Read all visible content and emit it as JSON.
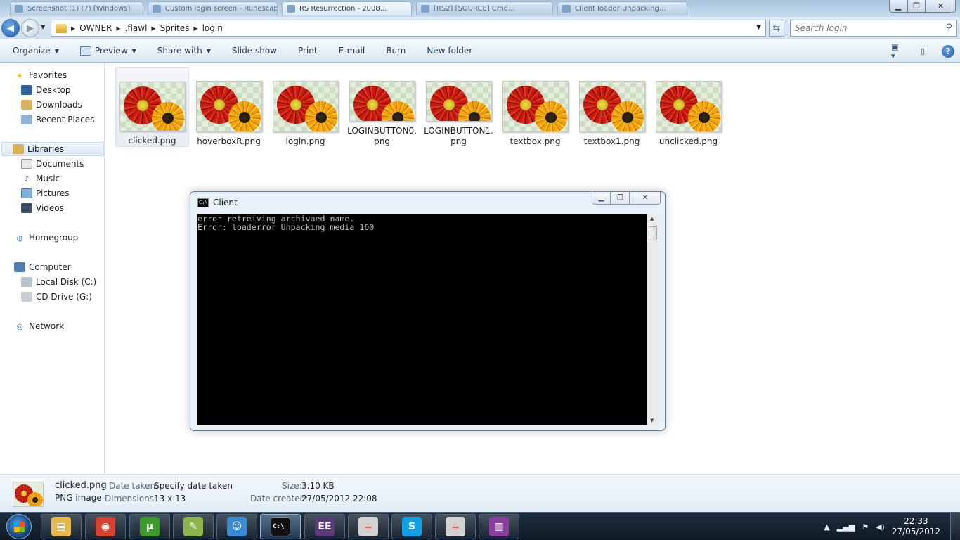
{
  "window": {
    "bg_tabs": [
      "Screenshot (1) (7) [Windows]",
      "Custom login screen - Runescape",
      "RS Resurrection - 2008...",
      "[RS2] [SOURCE] Cmd...",
      "Client loader Unpacking..."
    ],
    "controls": {
      "minimize": "▁",
      "restore": "❐",
      "close": "✕"
    }
  },
  "address_bar": {
    "breadcrumbs": [
      "OWNER",
      ".flawl",
      "Sprites",
      "login"
    ],
    "search_placeholder": "Search login"
  },
  "toolbar": {
    "organize": "Organize",
    "preview": "Preview",
    "share_with": "Share with",
    "slide_show": "Slide show",
    "print": "Print",
    "email": "E-mail",
    "burn": "Burn",
    "new_folder": "New folder"
  },
  "nav": {
    "favorites": "Favorites",
    "desktop": "Desktop",
    "downloads": "Downloads",
    "recent_places": "Recent Places",
    "libraries": "Libraries",
    "documents": "Documents",
    "music": "Music",
    "pictures": "Pictures",
    "videos": "Videos",
    "homegroup": "Homegroup",
    "computer": "Computer",
    "local_disk": "Local Disk (C:)",
    "cd_drive": "CD Drive (G:)",
    "network": "Network"
  },
  "files": [
    {
      "name": "clicked.png",
      "selected": true
    },
    {
      "name": "hoverboxR.png",
      "selected": false
    },
    {
      "name": "login.png",
      "selected": false
    },
    {
      "name": "LOGINBUTTON0.png",
      "selected": false
    },
    {
      "name": "LOGINBUTTON1.png",
      "selected": false
    },
    {
      "name": "textbox.png",
      "selected": false
    },
    {
      "name": "textbox1.png",
      "selected": false
    },
    {
      "name": "unclicked.png",
      "selected": false
    }
  ],
  "console": {
    "title": "Client",
    "icon_text": "C:\\_",
    "lines": [
      "error retreiving archivaed name.",
      "Error: loaderror Unpacking media 160"
    ]
  },
  "details": {
    "filename": "clicked.png",
    "filetype": "PNG image",
    "date_taken_label": "Date taken:",
    "date_taken_value": "Specify date taken",
    "dimensions_label": "Dimensions:",
    "dimensions_value": "13 x 13",
    "size_label": "Size:",
    "size_value": "3.10 KB",
    "date_created_label": "Date created:",
    "date_created_value": "27/05/2012 22:08"
  },
  "taskbar": {
    "apps": [
      {
        "name": "windows-explorer",
        "glyph": "▤",
        "color": "#e9b84a",
        "active": false
      },
      {
        "name": "google-chrome",
        "glyph": "◉",
        "color": "#d64232",
        "active": false
      },
      {
        "name": "utorrent",
        "glyph": "µ",
        "color": "#3c9a2c",
        "active": false
      },
      {
        "name": "notepad-plus",
        "glyph": "✎",
        "color": "#8bb44a",
        "active": false
      },
      {
        "name": "windows-live-messenger",
        "glyph": "☺",
        "color": "#3a8ad6",
        "active": false
      },
      {
        "name": "command-prompt",
        "glyph": "C:\\_",
        "color": "#111111",
        "active": true
      },
      {
        "name": "eclipse-java-ee",
        "glyph": "EE",
        "color": "#5b3a7a",
        "active": false
      },
      {
        "name": "java",
        "glyph": "☕",
        "color": "#d2d2d2",
        "active": false
      },
      {
        "name": "skype",
        "glyph": "S",
        "color": "#0fa0e6",
        "active": false
      },
      {
        "name": "java-2",
        "glyph": "☕",
        "color": "#d2d2d2",
        "active": false
      },
      {
        "name": "winrar",
        "glyph": "▥",
        "color": "#8a3fa0",
        "active": false
      }
    ],
    "time": "22:33",
    "date": "27/05/2012"
  }
}
